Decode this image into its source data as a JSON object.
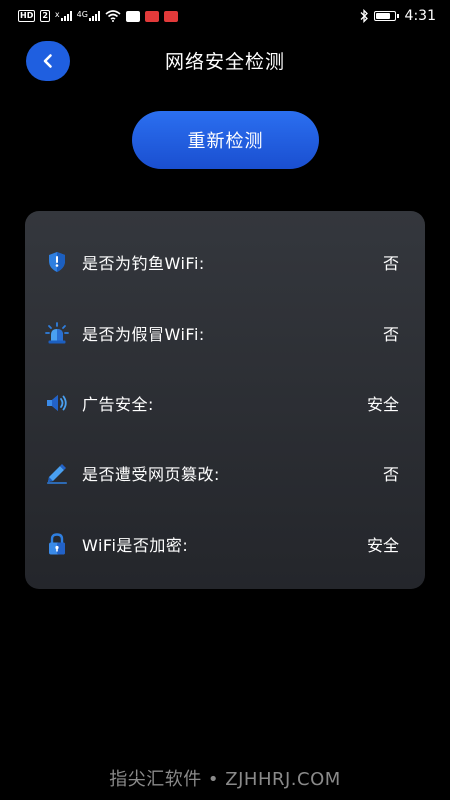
{
  "status_bar": {
    "left_badge_1": "HD",
    "left_badge_2": "2",
    "network_1": "x",
    "network_2": "4G",
    "time": "4:31",
    "battery_level": 0.85
  },
  "header": {
    "title": "网络安全检测"
  },
  "actions": {
    "recheck_label": "重新检测"
  },
  "results": [
    {
      "icon": "shield-icon",
      "label": "是否为钓鱼WiFi:",
      "value": "否"
    },
    {
      "icon": "alarm-light-icon",
      "label": "是否为假冒WiFi:",
      "value": "否"
    },
    {
      "icon": "speaker-icon",
      "label": "广告安全:",
      "value": "安全"
    },
    {
      "icon": "pencil-icon",
      "label": "是否遭受网页篡改:",
      "value": "否"
    },
    {
      "icon": "lock-icon",
      "label": "WiFi是否加密:",
      "value": "安全"
    }
  ],
  "watermark": {
    "text": "指尖汇软件 • ZJHHRJ.COM"
  },
  "colors": {
    "background": "#000000",
    "accent": "#1f5fe0",
    "card": "#2c2f34",
    "text": "#ffffff"
  }
}
